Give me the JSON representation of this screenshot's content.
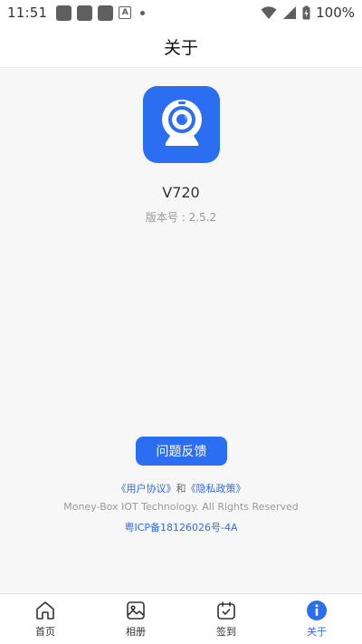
{
  "status_bar": {
    "time": "11:51",
    "battery": "100%"
  },
  "title": "关于",
  "app": {
    "name": "V720",
    "version": "版本号 : 2.5.2",
    "logo": "webcam-icon"
  },
  "feedback_button": "问题反馈",
  "links": {
    "user_agreement": "《用户协议》",
    "and": "和",
    "privacy_policy": "《隐私政策》"
  },
  "copyright": "Money-Box IOT Technology. All Rights Reserved",
  "icp": "粤ICP备18126026号-4A",
  "nav": [
    {
      "label": "首页",
      "icon": "home-icon",
      "active": false
    },
    {
      "label": "相册",
      "icon": "album-icon",
      "active": false
    },
    {
      "label": "签到",
      "icon": "calendar-check-icon",
      "active": false
    },
    {
      "label": "关于",
      "icon": "info-icon",
      "active": true
    }
  ],
  "colors": {
    "accent": "#2c6ef2",
    "background": "#f7f7f7"
  }
}
